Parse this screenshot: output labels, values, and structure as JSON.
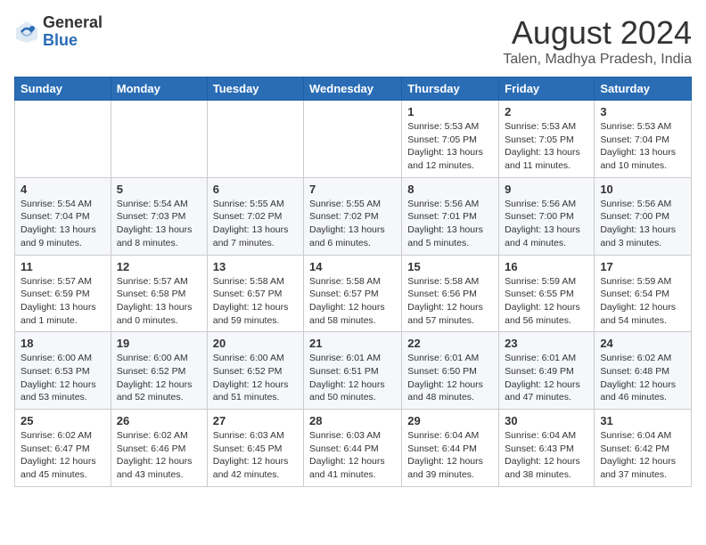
{
  "header": {
    "logo": {
      "line1": "General",
      "line2": "Blue"
    },
    "title": "August 2024",
    "subtitle": "Talen, Madhya Pradesh, India"
  },
  "weekdays": [
    "Sunday",
    "Monday",
    "Tuesday",
    "Wednesday",
    "Thursday",
    "Friday",
    "Saturday"
  ],
  "weeks": [
    [
      {
        "day": "",
        "info": ""
      },
      {
        "day": "",
        "info": ""
      },
      {
        "day": "",
        "info": ""
      },
      {
        "day": "",
        "info": ""
      },
      {
        "day": "1",
        "info": "Sunrise: 5:53 AM\nSunset: 7:05 PM\nDaylight: 13 hours\nand 12 minutes."
      },
      {
        "day": "2",
        "info": "Sunrise: 5:53 AM\nSunset: 7:05 PM\nDaylight: 13 hours\nand 11 minutes."
      },
      {
        "day": "3",
        "info": "Sunrise: 5:53 AM\nSunset: 7:04 PM\nDaylight: 13 hours\nand 10 minutes."
      }
    ],
    [
      {
        "day": "4",
        "info": "Sunrise: 5:54 AM\nSunset: 7:04 PM\nDaylight: 13 hours\nand 9 minutes."
      },
      {
        "day": "5",
        "info": "Sunrise: 5:54 AM\nSunset: 7:03 PM\nDaylight: 13 hours\nand 8 minutes."
      },
      {
        "day": "6",
        "info": "Sunrise: 5:55 AM\nSunset: 7:02 PM\nDaylight: 13 hours\nand 7 minutes."
      },
      {
        "day": "7",
        "info": "Sunrise: 5:55 AM\nSunset: 7:02 PM\nDaylight: 13 hours\nand 6 minutes."
      },
      {
        "day": "8",
        "info": "Sunrise: 5:56 AM\nSunset: 7:01 PM\nDaylight: 13 hours\nand 5 minutes."
      },
      {
        "day": "9",
        "info": "Sunrise: 5:56 AM\nSunset: 7:00 PM\nDaylight: 13 hours\nand 4 minutes."
      },
      {
        "day": "10",
        "info": "Sunrise: 5:56 AM\nSunset: 7:00 PM\nDaylight: 13 hours\nand 3 minutes."
      }
    ],
    [
      {
        "day": "11",
        "info": "Sunrise: 5:57 AM\nSunset: 6:59 PM\nDaylight: 13 hours\nand 1 minute."
      },
      {
        "day": "12",
        "info": "Sunrise: 5:57 AM\nSunset: 6:58 PM\nDaylight: 13 hours\nand 0 minutes."
      },
      {
        "day": "13",
        "info": "Sunrise: 5:58 AM\nSunset: 6:57 PM\nDaylight: 12 hours\nand 59 minutes."
      },
      {
        "day": "14",
        "info": "Sunrise: 5:58 AM\nSunset: 6:57 PM\nDaylight: 12 hours\nand 58 minutes."
      },
      {
        "day": "15",
        "info": "Sunrise: 5:58 AM\nSunset: 6:56 PM\nDaylight: 12 hours\nand 57 minutes."
      },
      {
        "day": "16",
        "info": "Sunrise: 5:59 AM\nSunset: 6:55 PM\nDaylight: 12 hours\nand 56 minutes."
      },
      {
        "day": "17",
        "info": "Sunrise: 5:59 AM\nSunset: 6:54 PM\nDaylight: 12 hours\nand 54 minutes."
      }
    ],
    [
      {
        "day": "18",
        "info": "Sunrise: 6:00 AM\nSunset: 6:53 PM\nDaylight: 12 hours\nand 53 minutes."
      },
      {
        "day": "19",
        "info": "Sunrise: 6:00 AM\nSunset: 6:52 PM\nDaylight: 12 hours\nand 52 minutes."
      },
      {
        "day": "20",
        "info": "Sunrise: 6:00 AM\nSunset: 6:52 PM\nDaylight: 12 hours\nand 51 minutes."
      },
      {
        "day": "21",
        "info": "Sunrise: 6:01 AM\nSunset: 6:51 PM\nDaylight: 12 hours\nand 50 minutes."
      },
      {
        "day": "22",
        "info": "Sunrise: 6:01 AM\nSunset: 6:50 PM\nDaylight: 12 hours\nand 48 minutes."
      },
      {
        "day": "23",
        "info": "Sunrise: 6:01 AM\nSunset: 6:49 PM\nDaylight: 12 hours\nand 47 minutes."
      },
      {
        "day": "24",
        "info": "Sunrise: 6:02 AM\nSunset: 6:48 PM\nDaylight: 12 hours\nand 46 minutes."
      }
    ],
    [
      {
        "day": "25",
        "info": "Sunrise: 6:02 AM\nSunset: 6:47 PM\nDaylight: 12 hours\nand 45 minutes."
      },
      {
        "day": "26",
        "info": "Sunrise: 6:02 AM\nSunset: 6:46 PM\nDaylight: 12 hours\nand 43 minutes."
      },
      {
        "day": "27",
        "info": "Sunrise: 6:03 AM\nSunset: 6:45 PM\nDaylight: 12 hours\nand 42 minutes."
      },
      {
        "day": "28",
        "info": "Sunrise: 6:03 AM\nSunset: 6:44 PM\nDaylight: 12 hours\nand 41 minutes."
      },
      {
        "day": "29",
        "info": "Sunrise: 6:04 AM\nSunset: 6:44 PM\nDaylight: 12 hours\nand 39 minutes."
      },
      {
        "day": "30",
        "info": "Sunrise: 6:04 AM\nSunset: 6:43 PM\nDaylight: 12 hours\nand 38 minutes."
      },
      {
        "day": "31",
        "info": "Sunrise: 6:04 AM\nSunset: 6:42 PM\nDaylight: 12 hours\nand 37 minutes."
      }
    ]
  ]
}
